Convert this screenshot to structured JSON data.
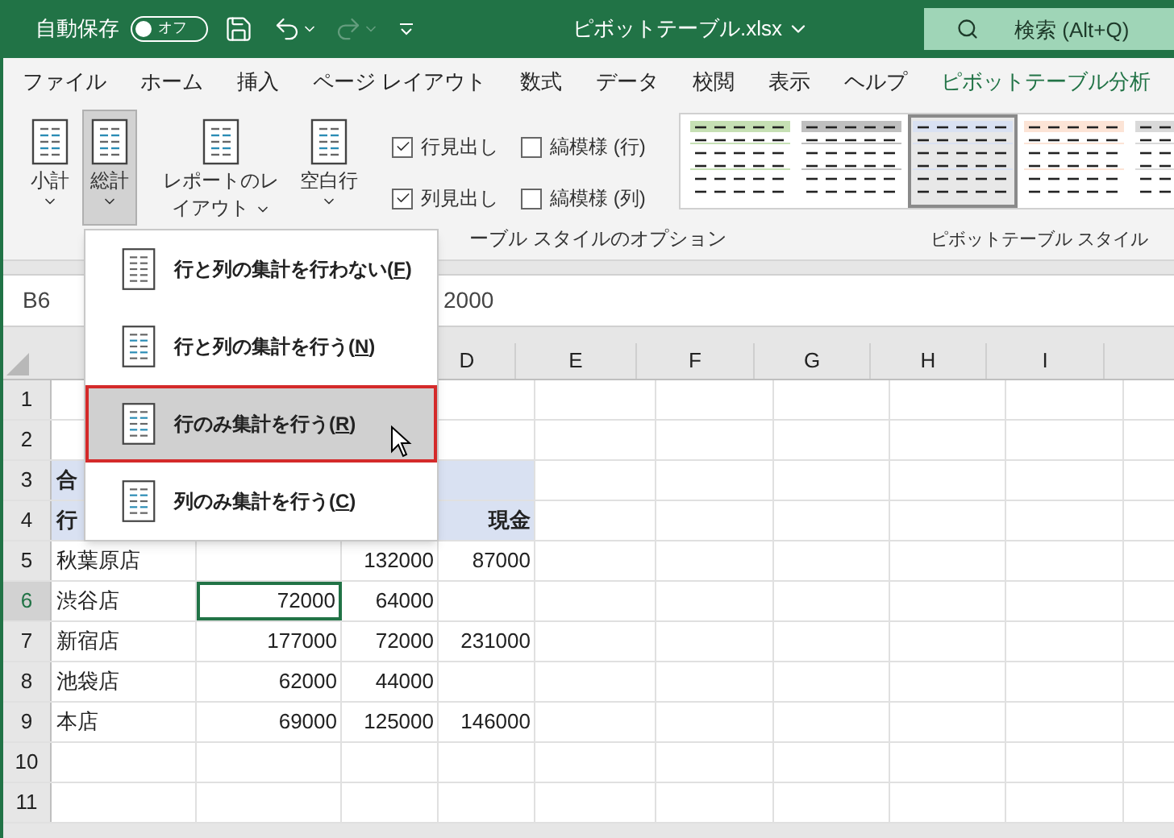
{
  "title_bar": {
    "autosave_label": "自動保存",
    "autosave": {
      "label": "オフ",
      "on": false
    },
    "redo_disabled": true,
    "file_name": "ピボットテーブル.xlsx",
    "search": {
      "placeholder": "検索 (Alt+Q)"
    }
  },
  "tabs": [
    {
      "label": "ファイル",
      "selected": false
    },
    {
      "label": "ホーム",
      "selected": false
    },
    {
      "label": "挿入",
      "selected": false
    },
    {
      "label": "ページ レイアウト",
      "selected": false
    },
    {
      "label": "数式",
      "selected": false
    },
    {
      "label": "データ",
      "selected": false
    },
    {
      "label": "校閲",
      "selected": false
    },
    {
      "label": "表示",
      "selected": false
    },
    {
      "label": "ヘルプ",
      "selected": false
    },
    {
      "label": "ピボットテーブル分析",
      "selected": true
    }
  ],
  "ribbon": {
    "layout_buttons": [
      {
        "lines": [
          "小計"
        ],
        "pressed": false
      },
      {
        "lines": [
          "総計"
        ],
        "pressed": true
      },
      {
        "lines": [
          "レポートのレ",
          "イアウト"
        ],
        "pressed": false
      },
      {
        "lines": [
          "空白行"
        ],
        "pressed": false
      }
    ],
    "options": [
      {
        "label": "行見出し",
        "checked": true
      },
      {
        "label": "縞模様 (行)",
        "checked": false
      },
      {
        "label": "列見出し",
        "checked": true
      },
      {
        "label": "縞模様 (列)",
        "checked": false
      }
    ],
    "options_label": "ーブル スタイルのオプション",
    "styles": [
      {
        "color": "#c6e0b4",
        "selected": false
      },
      {
        "color": "#bfbfbf",
        "selected": false
      },
      {
        "color": "#d9e1f2",
        "selected": true
      },
      {
        "color": "#fce4d6",
        "selected": false
      },
      {
        "color": "#d9d9d9",
        "selected": false
      }
    ],
    "styles_label": "ピボットテーブル スタイル"
  },
  "formula_bar": {
    "name_box": "B6",
    "formula": "2000"
  },
  "sheet": {
    "columns": [
      "",
      "",
      "",
      "D",
      "E",
      "F",
      "G",
      "H",
      "I"
    ],
    "rows": [
      {
        "number": "1",
        "selected": false,
        "cells": [
          "",
          "",
          "",
          ""
        ]
      },
      {
        "number": "2",
        "selected": false,
        "cells": [
          "",
          "",
          "",
          ""
        ]
      },
      {
        "number": "3",
        "selected": false,
        "kind": "pivot_header",
        "cells": [
          "合",
          "",
          "",
          ""
        ]
      },
      {
        "number": "4",
        "selected": false,
        "kind": "pivot_header",
        "cells": [
          "行",
          "",
          "",
          "現金"
        ]
      },
      {
        "number": "5",
        "selected": false,
        "cells": [
          "秋葉原店",
          "",
          "132000",
          "87000"
        ]
      },
      {
        "number": "6",
        "selected": true,
        "selection": [
          false,
          true,
          false,
          false
        ],
        "cells": [
          "渋谷店",
          "72000",
          "64000",
          ""
        ]
      },
      {
        "number": "7",
        "selected": false,
        "cells": [
          "新宿店",
          "177000",
          "72000",
          "231000"
        ]
      },
      {
        "number": "8",
        "selected": false,
        "cells": [
          "池袋店",
          "62000",
          "44000",
          ""
        ]
      },
      {
        "number": "9",
        "selected": false,
        "cells": [
          "本店",
          "69000",
          "125000",
          "146000"
        ]
      },
      {
        "number": "10",
        "selected": false,
        "cells": [
          "",
          "",
          "",
          ""
        ]
      },
      {
        "number": "11",
        "selected": false,
        "cells": [
          "",
          "",
          "",
          ""
        ]
      }
    ]
  },
  "menu": {
    "items": [
      {
        "before": "行と列の集計を行わない(",
        "accelerator": "F",
        "after": ")",
        "selected": false
      },
      {
        "before": "行と列の集計を行う(",
        "accelerator": "N",
        "after": ")",
        "selected": false
      },
      {
        "before": "行のみ集計を行う(",
        "accelerator": "R",
        "after": ")",
        "selected": true
      },
      {
        "before": "列のみ集計を行う(",
        "accelerator": "C",
        "after": ")",
        "selected": false
      }
    ]
  }
}
